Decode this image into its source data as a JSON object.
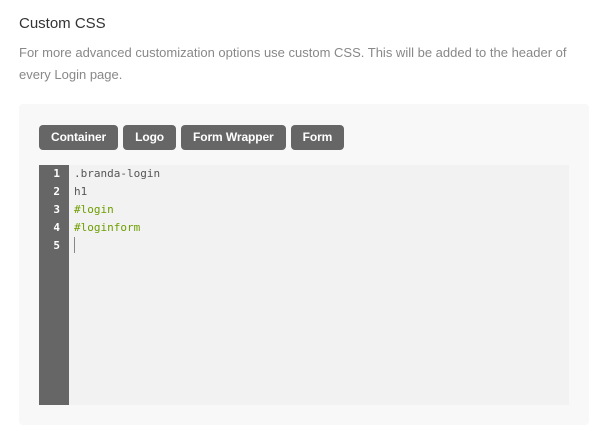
{
  "header": {
    "title": "Custom CSS",
    "description": "For more advanced customization options use custom CSS. This will be added to the header of every Login page."
  },
  "buttons": [
    "Container",
    "Logo",
    "Form Wrapper",
    "Form"
  ],
  "editor": {
    "line_numbers": [
      "1",
      "2",
      "3",
      "4",
      "5"
    ],
    "lines": [
      ".branda-login",
      "h1",
      "#login",
      "#loginform",
      ""
    ]
  },
  "colors": {
    "button_bg": "#666666",
    "gutter_bg": "#666666",
    "editor_bg": "#f2f2f2",
    "id_selector": "#6e9e00"
  }
}
